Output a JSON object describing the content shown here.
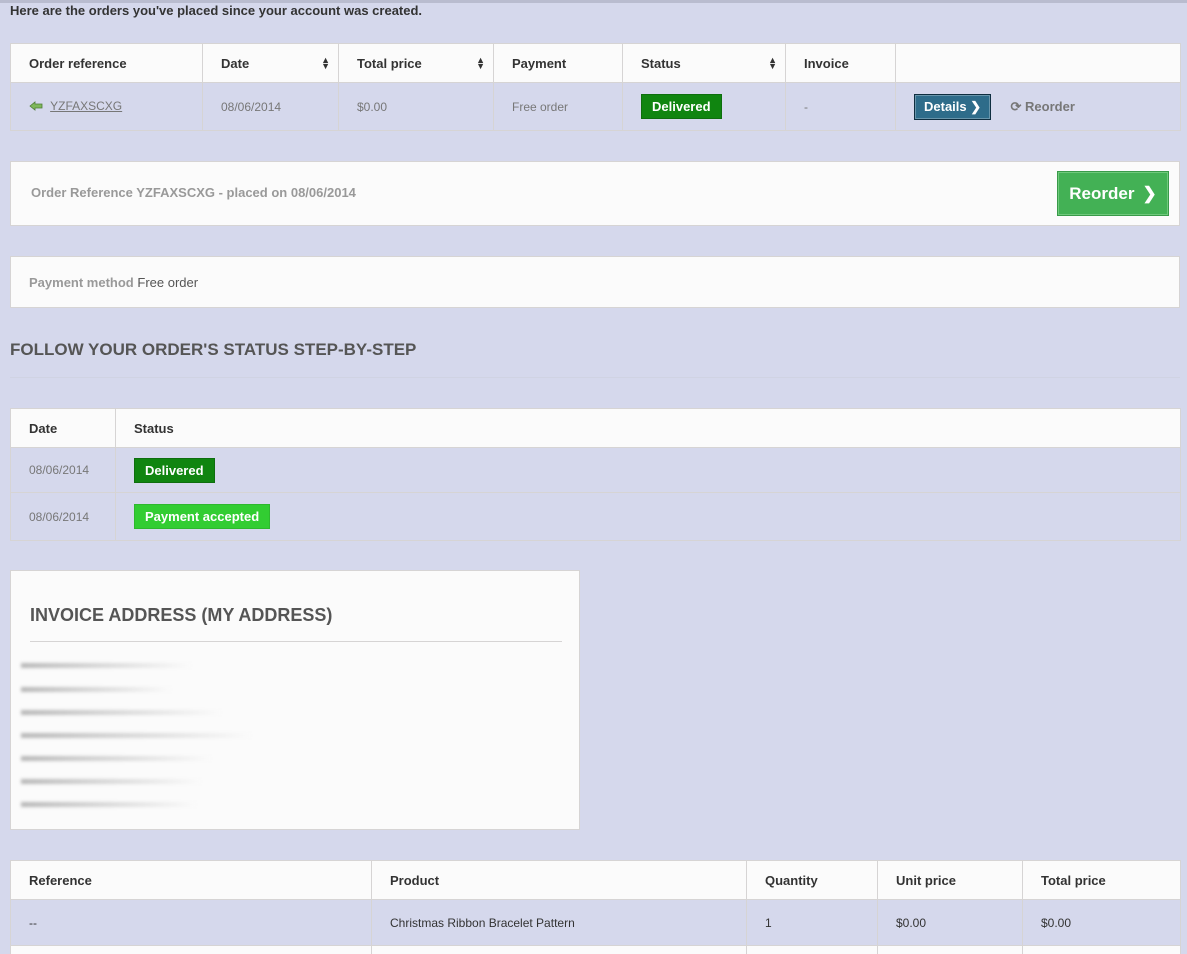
{
  "intro_text": "Here are the orders you've placed since your account was created.",
  "orders_table": {
    "headers": [
      "Order reference",
      "Date",
      "Total price",
      "Payment",
      "Status",
      "Invoice",
      ""
    ],
    "rows": [
      {
        "reference": "YZFAXSCXG",
        "date": "08/06/2014",
        "total_price": "$0.00",
        "payment": "Free order",
        "status": "Delivered",
        "invoice": "-",
        "details_label": "Details",
        "reorder_label": "Reorder"
      }
    ]
  },
  "order_info": {
    "text": "Order Reference YZFAXSCXG - placed on 08/06/2014",
    "reorder_button": "Reorder"
  },
  "payment_box": {
    "label": "Payment method",
    "value": "Free order"
  },
  "follow_heading": "FOLLOW YOUR ORDER'S STATUS STEP-BY-STEP",
  "history_table": {
    "headers": [
      "Date",
      "Status"
    ],
    "rows": [
      {
        "date": "08/06/2014",
        "status": "Delivered"
      },
      {
        "date": "08/06/2014",
        "status": "Payment accepted"
      }
    ]
  },
  "invoice_address": {
    "title": "INVOICE ADDRESS (MY ADDRESS)"
  },
  "products_table": {
    "headers": [
      "Reference",
      "Product",
      "Quantity",
      "Unit price",
      "Total price"
    ],
    "rows": [
      {
        "reference": "--",
        "product": "Christmas Ribbon Bracelet Pattern",
        "quantity": "1",
        "unit_price": "$0.00",
        "total_price": "$0.00"
      }
    ]
  },
  "colors": {
    "page_bg": "#d5d8ec",
    "delivered": "#108510",
    "payment_accepted": "#32cd32",
    "details_button": "#2e6c8a",
    "reorder_button": "#43b155"
  }
}
